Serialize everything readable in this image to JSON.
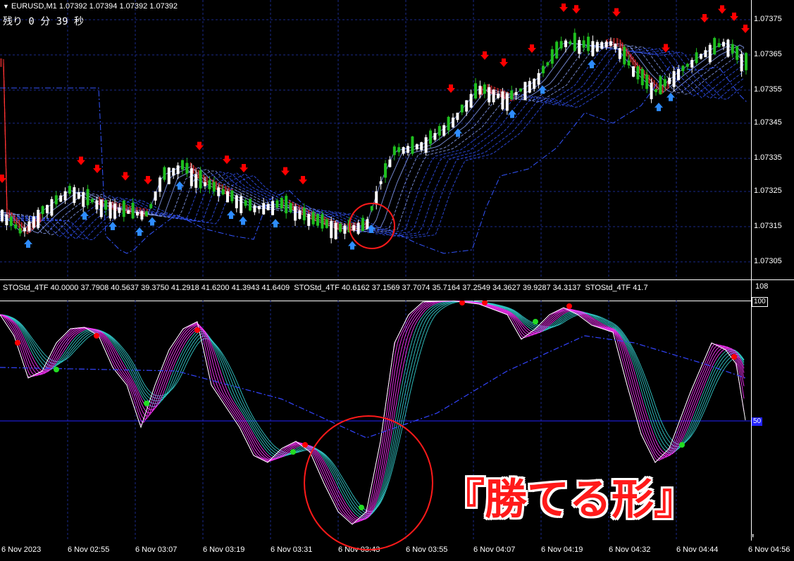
{
  "window": {
    "symbol_info": "EURUSD,M1  1.07392 1.07394 1.07392 1.07392",
    "timer": "残り 0 分 39 秒",
    "menu_arrow": "triangle-down-icon"
  },
  "main_chart": {
    "price_ticks": [
      "1.07375",
      "1.07365",
      "1.07355",
      "1.07345",
      "1.07335",
      "1.07325",
      "1.07315",
      "1.07305"
    ],
    "price_range": [
      1.073,
      1.0738
    ],
    "colors": {
      "bull_candle": "#1fbf1f",
      "bear_candle": "#ffffff",
      "grid": "#1a2a8a",
      "down_arrow": "#ff0000",
      "up_arrow": "#2e8cff",
      "red_band": "#ff3333",
      "blue_band": "#3355ff"
    }
  },
  "indicator": {
    "header": "STOStd_4TF 40.0000 37.7908 40.5637 39.3750 41.2918 41.6200 41.3943 41.6409  STOStd_4TF 40.6162 37.1569 37.7074 35.7164 37.2549 34.3627 39.9287 34.3137  STOStd_4TF 41.7",
    "top_value": "108",
    "level_100": "100",
    "level_50": "50",
    "colors": {
      "line_main": "#ffffff",
      "fan_pink": "#ff33ff",
      "fan_cyan": "#33cccc",
      "level_line": "#2222ff",
      "dot_red": "#ff0000",
      "dot_green": "#22dd22"
    }
  },
  "time_axis": [
    "6 Nov 2023",
    "6 Nov 02:55",
    "6 Nov 03:07",
    "6 Nov 03:19",
    "6 Nov 03:31",
    "6 Nov 03:43",
    "6 Nov 03:55",
    "6 Nov 04:07",
    "6 Nov 04:19",
    "6 Nov 04:32",
    "6 Nov 04:44",
    "6 Nov 04:56"
  ],
  "annotation": {
    "caption": "『勝てる形』",
    "circle_color": "#ff0000"
  }
}
